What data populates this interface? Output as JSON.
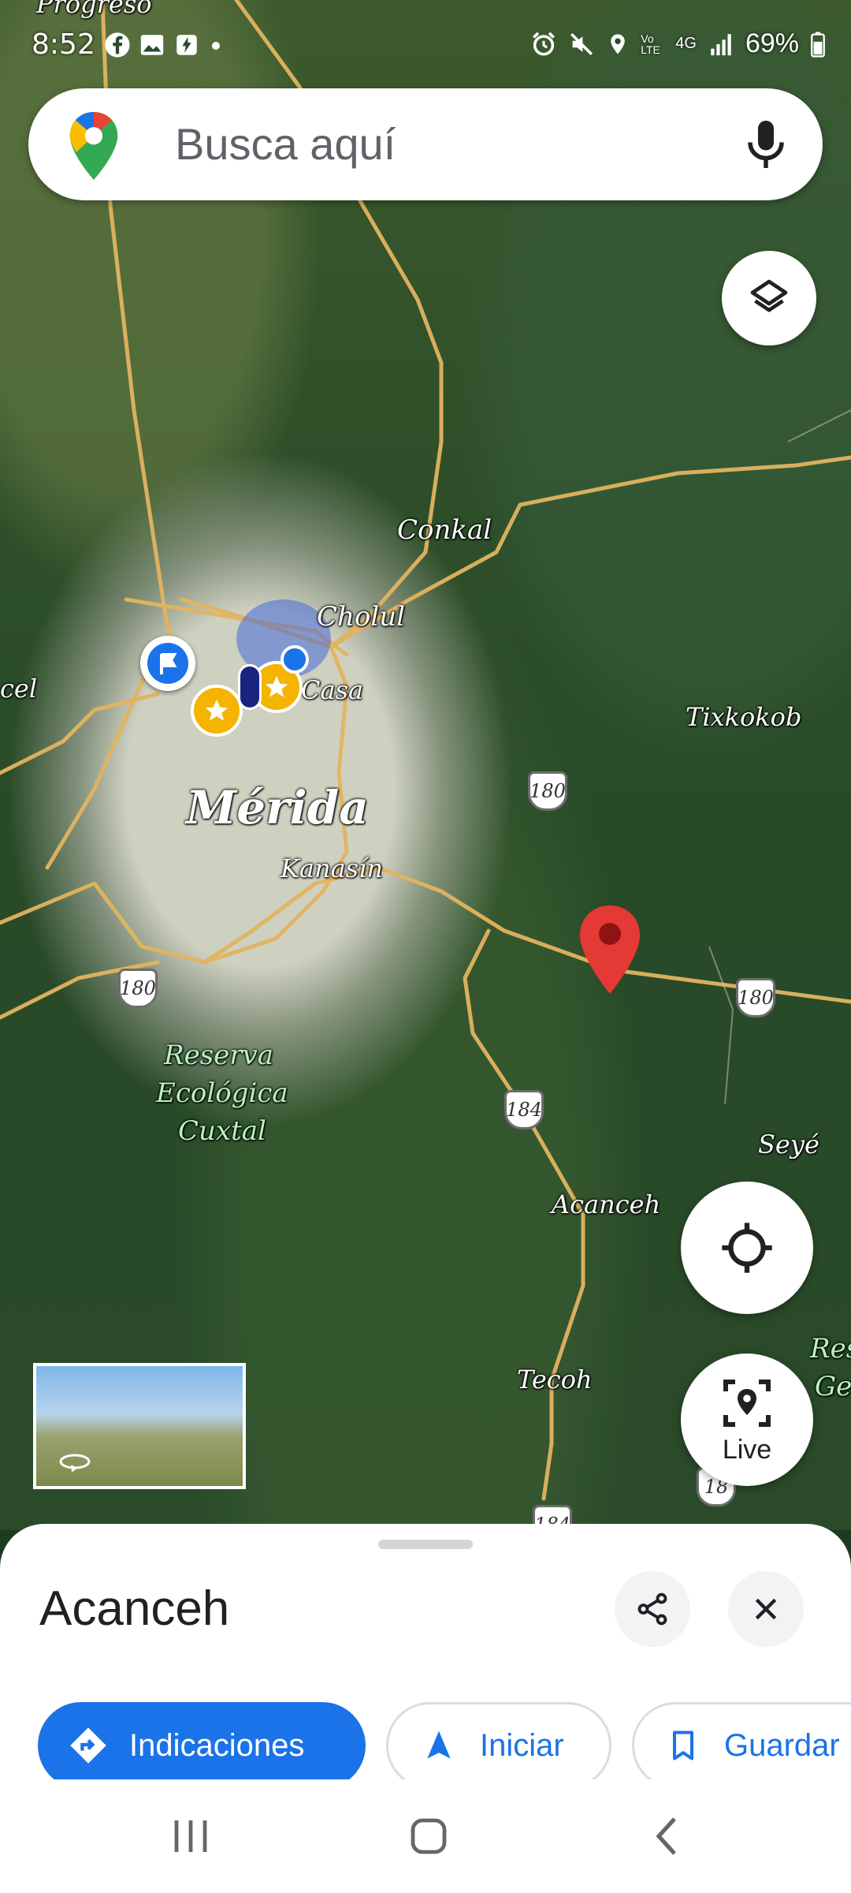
{
  "status_bar": {
    "time": "8:52",
    "battery": "69%",
    "network": "4G",
    "volte": "Vo LTE"
  },
  "search": {
    "placeholder": "Busca aquí"
  },
  "map": {
    "labels": {
      "progreso": "Progreso",
      "conkal": "Conkal",
      "cholul": "Cholul",
      "casa": "Casa",
      "merida": "Mérida",
      "kanasin": "Kanasín",
      "tixkokob": "Tixkokob",
      "acanceh": "Acanceh",
      "tecoh": "Tecoh",
      "seye": "Seyé",
      "cel": "cel",
      "reserva": "Reserva",
      "ecologica": "Ecológica",
      "cuxtal": "Cuxtal",
      "res_right": "Res",
      "ge_right": "Ge"
    },
    "shields": {
      "s180_a": "180",
      "s180_b": "180",
      "s180_c": "180",
      "s184_a": "184",
      "s184_b": "184",
      "s18": "18"
    }
  },
  "live": {
    "label": "Live"
  },
  "sheet": {
    "title": "Acanceh",
    "buttons": {
      "directions": "Indicaciones",
      "start": "Iniciar",
      "save": "Guardar"
    }
  },
  "colors": {
    "accent": "#1a73e8",
    "pin_red": "#e53935",
    "star_yellow": "#f4b400"
  }
}
